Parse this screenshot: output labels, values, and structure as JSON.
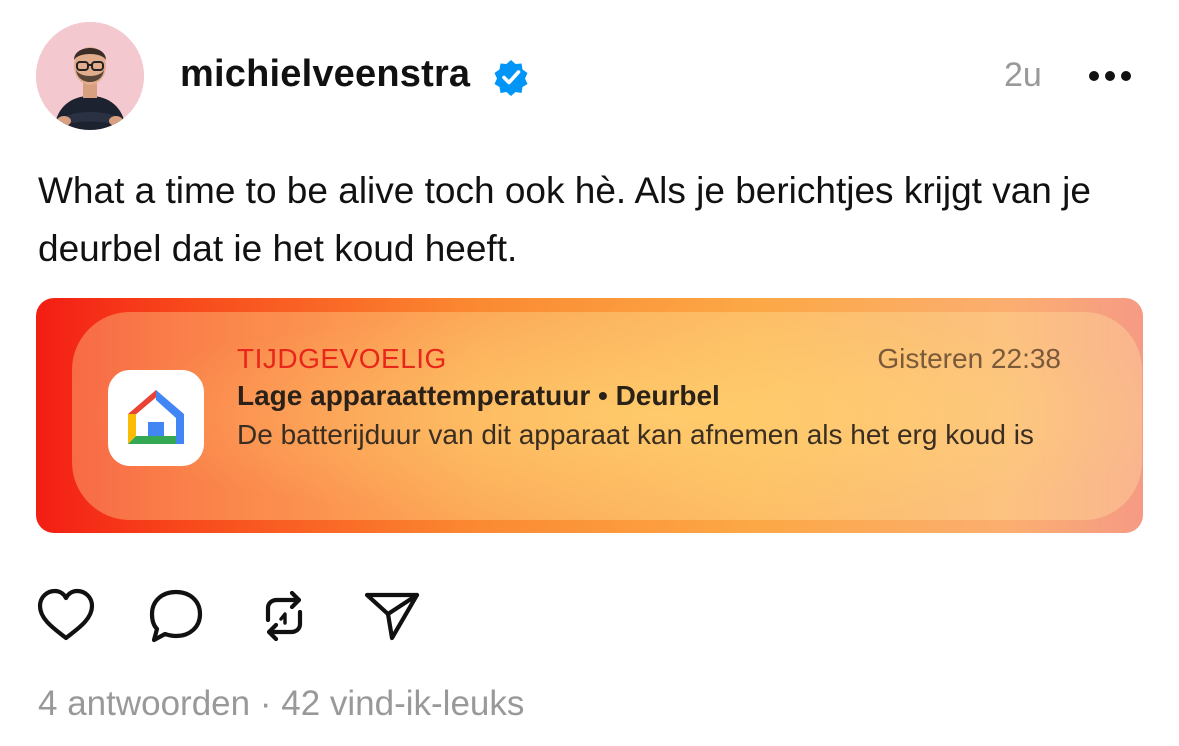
{
  "post": {
    "username": "michielveenstra",
    "verified_icon": "verified-badge-icon",
    "time": "2u",
    "more_icon": "more-icon",
    "text": "What a time to be alive toch ook hè. Als je berichtjes krijgt van je deurbel dat ie het koud heeft."
  },
  "notification": {
    "category": "TIJDGEVOELIG",
    "time": "Gisteren 22:38",
    "title": "Lage apparaattemperatuur • Deurbel",
    "body": "De batterijduur van dit apparaat kan afnemen als het erg koud is",
    "app_icon": "google-home-icon"
  },
  "actions": [
    {
      "name": "like",
      "icon": "heart-icon"
    },
    {
      "name": "reply",
      "icon": "comment-icon"
    },
    {
      "name": "repost",
      "icon": "repost-icon"
    },
    {
      "name": "share",
      "icon": "send-icon"
    }
  ],
  "stats": {
    "replies": "4 antwoorden",
    "separator": "·",
    "likes": "42 vind-ik-leuks"
  },
  "colors": {
    "verified": "#0095f6",
    "category_red": "#e8271a",
    "muted": "#999999"
  }
}
